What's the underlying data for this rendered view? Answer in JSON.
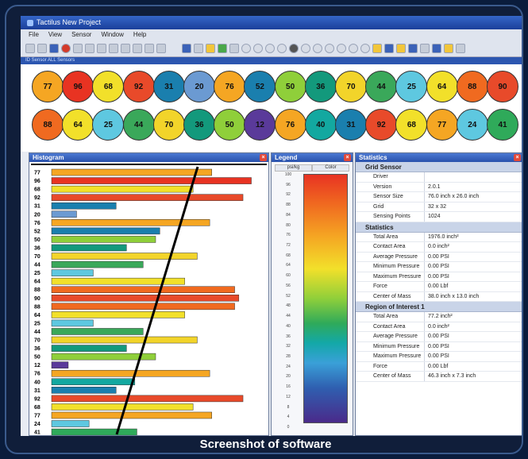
{
  "window": {
    "title": "Tactilus  New Project"
  },
  "menu": [
    "File",
    "View",
    "Sensor",
    "Window",
    "Help"
  ],
  "subbar_text": "ID Sensor  ALL Sensors",
  "sensor_values": [
    [
      {
        "v": "77",
        "c": "#f5a623"
      },
      {
        "v": "96",
        "c": "#e83322"
      },
      {
        "v": "68",
        "c": "#f2e02a"
      },
      {
        "v": "92",
        "c": "#e84a2a"
      },
      {
        "v": "31",
        "c": "#1a7fae"
      },
      {
        "v": "20",
        "c": "#6b9ad2"
      },
      {
        "v": "76",
        "c": "#f5a623"
      },
      {
        "v": "52",
        "c": "#1a7fae"
      },
      {
        "v": "50",
        "c": "#8fcf3a"
      },
      {
        "v": "36",
        "c": "#13997c"
      },
      {
        "v": "70",
        "c": "#f2d42a"
      },
      {
        "v": "44",
        "c": "#3aa85a"
      },
      {
        "v": "25",
        "c": "#5ec8e0"
      },
      {
        "v": "64",
        "c": "#f2e02a"
      },
      {
        "v": "88",
        "c": "#f06a20"
      },
      {
        "v": "90",
        "c": "#e84a2a"
      }
    ],
    [
      {
        "v": "88",
        "c": "#f06a20"
      },
      {
        "v": "64",
        "c": "#f2e02a"
      },
      {
        "v": "25",
        "c": "#5ec8e0"
      },
      {
        "v": "44",
        "c": "#3aa85a"
      },
      {
        "v": "70",
        "c": "#f2d42a"
      },
      {
        "v": "36",
        "c": "#13997c"
      },
      {
        "v": "50",
        "c": "#8fcf3a"
      },
      {
        "v": "12",
        "c": "#5a3a9a"
      },
      {
        "v": "76",
        "c": "#f5a623"
      },
      {
        "v": "40",
        "c": "#13a8a0"
      },
      {
        "v": "31",
        "c": "#1a7fae"
      },
      {
        "v": "92",
        "c": "#e84a2a"
      },
      {
        "v": "68",
        "c": "#f2e02a"
      },
      {
        "v": "77",
        "c": "#f5a623"
      },
      {
        "v": "24",
        "c": "#5ec8e0"
      },
      {
        "v": "41",
        "c": "#2faa5a"
      }
    ]
  ],
  "histogram": {
    "title": "Histogram",
    "rows": [
      {
        "label": "77",
        "value": 77,
        "color": "#f5a623"
      },
      {
        "label": "96",
        "value": 96,
        "color": "#e83322"
      },
      {
        "label": "68",
        "value": 68,
        "color": "#f2e02a"
      },
      {
        "label": "92",
        "value": 92,
        "color": "#e84a2a"
      },
      {
        "label": "31",
        "value": 31,
        "color": "#1a7fae"
      },
      {
        "label": "20",
        "value": 12,
        "color": "#6b9ad2"
      },
      {
        "label": "76",
        "value": 76,
        "color": "#f5a623"
      },
      {
        "label": "52",
        "value": 52,
        "color": "#1a7fae"
      },
      {
        "label": "50",
        "value": 50,
        "color": "#8fcf3a"
      },
      {
        "label": "36",
        "value": 36,
        "color": "#13997c"
      },
      {
        "label": "70",
        "value": 70,
        "color": "#f2d42a"
      },
      {
        "label": "44",
        "value": 44,
        "color": "#3aa85a"
      },
      {
        "label": "25",
        "value": 20,
        "color": "#5ec8e0"
      },
      {
        "label": "64",
        "value": 64,
        "color": "#f2e02a"
      },
      {
        "label": "88",
        "value": 88,
        "color": "#f06a20"
      },
      {
        "label": "90",
        "value": 90,
        "color": "#e84a2a"
      },
      {
        "label": "88",
        "value": 88,
        "color": "#f06a20"
      },
      {
        "label": "64",
        "value": 64,
        "color": "#f2e02a"
      },
      {
        "label": "25",
        "value": 20,
        "color": "#5ec8e0"
      },
      {
        "label": "44",
        "value": 44,
        "color": "#3aa85a"
      },
      {
        "label": "70",
        "value": 70,
        "color": "#f2d42a"
      },
      {
        "label": "36",
        "value": 36,
        "color": "#13997c"
      },
      {
        "label": "50",
        "value": 50,
        "color": "#8fcf3a"
      },
      {
        "label": "12",
        "value": 8,
        "color": "#5a3a9a"
      },
      {
        "label": "76",
        "value": 76,
        "color": "#f5a623"
      },
      {
        "label": "40",
        "value": 40,
        "color": "#13a8a0"
      },
      {
        "label": "31",
        "value": 31,
        "color": "#1a7fae"
      },
      {
        "label": "92",
        "value": 92,
        "color": "#e84a2a"
      },
      {
        "label": "68",
        "value": 68,
        "color": "#f2e02a"
      },
      {
        "label": "77",
        "value": 77,
        "color": "#f5a623"
      },
      {
        "label": "24",
        "value": 18,
        "color": "#5ec8e0"
      },
      {
        "label": "41",
        "value": 41,
        "color": "#2faa5a"
      }
    ],
    "max": 100
  },
  "legend": {
    "title": "Legend",
    "col1": "psi/kg",
    "col2": "Color",
    "ticks": [
      "100",
      "96",
      "92",
      "88",
      "84",
      "80",
      "76",
      "72",
      "68",
      "64",
      "60",
      "56",
      "52",
      "48",
      "44",
      "40",
      "36",
      "32",
      "28",
      "24",
      "20",
      "16",
      "12",
      "8",
      "4",
      "0"
    ]
  },
  "stats": {
    "title": "Statistics",
    "sections": [
      {
        "title": "Grid Sensor",
        "rows": [
          {
            "k": "Driver",
            "v": ""
          },
          {
            "k": "Version",
            "v": "2.0.1"
          },
          {
            "k": "Sensor Size",
            "v": "76.0 inch x 26.0 inch"
          },
          {
            "k": "Grid",
            "v": "32 x 32"
          },
          {
            "k": "Sensing Points",
            "v": "1024"
          }
        ]
      },
      {
        "title": "Statistics",
        "rows": [
          {
            "k": "Total Area",
            "v": "1976.0 inch²"
          },
          {
            "k": "Contact Area",
            "v": "0.0 inch²"
          },
          {
            "k": "Average Pressure",
            "v": "0.00 PSI"
          },
          {
            "k": "Minimum Pressure",
            "v": "0.00 PSI"
          },
          {
            "k": "Maximum Pressure",
            "v": "0.00 PSI"
          },
          {
            "k": "Force",
            "v": "0.00 Lbf"
          },
          {
            "k": "Center of Mass",
            "v": "38.0 inch x 13.0 inch"
          }
        ]
      },
      {
        "title": "Region of Interest 1",
        "rows": [
          {
            "k": "Total Area",
            "v": "77.2 inch²"
          },
          {
            "k": "Contact Area",
            "v": "0.0 inch²"
          },
          {
            "k": "Average Pressure",
            "v": "0.00 PSI"
          },
          {
            "k": "Minimum Pressure",
            "v": "0.00 PSI"
          },
          {
            "k": "Maximum Pressure",
            "v": "0.00 PSI"
          },
          {
            "k": "Force",
            "v": "0.00 Lbf"
          },
          {
            "k": "Center of Mass",
            "v": "46.3 inch x 7.3 inch"
          }
        ]
      }
    ]
  },
  "caption": "Screenshot of software"
}
